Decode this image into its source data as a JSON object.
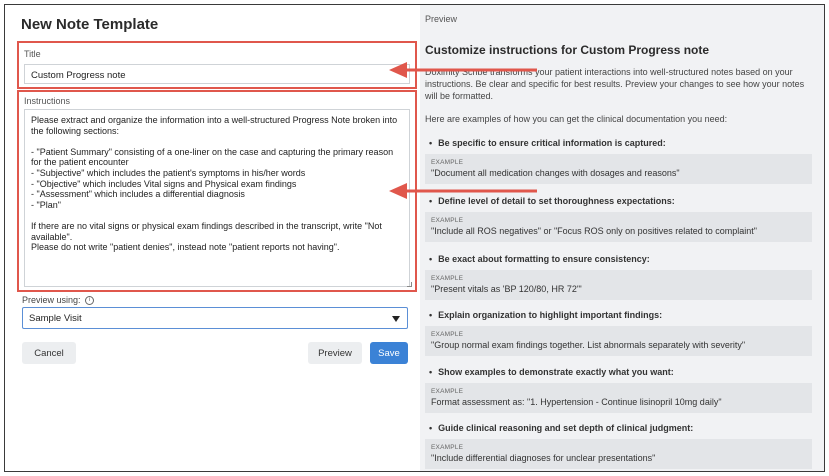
{
  "left": {
    "heading": "New Note Template",
    "title_label": "Title",
    "title_value": "Custom Progress note",
    "instructions_label": "Instructions",
    "instructions_value": "Please extract and organize the information into a well-structured Progress Note broken into the following sections:\n\n- \"Patient Summary\" consisting of a one-liner on the case and capturing the primary reason for the patient encounter\n- \"Subjective\" which includes the patient's symptoms in his/her words\n- \"Objective\" which includes Vital signs and Physical exam findings\n- \"Assessment\" which includes a differential diagnosis\n- \"Plan\"\n\nIf there are no vital signs or physical exam findings described in the transcript, write \"Not available\".\nPlease do not write \"patient denies\", instead note \"patient reports not having\".",
    "preview_using_label": "Preview using:",
    "preview_select_value": "Sample Visit",
    "cancel_label": "Cancel",
    "preview_label": "Preview",
    "save_label": "Save"
  },
  "right": {
    "tab_label": "Preview",
    "title": "Customize instructions for Custom Progress note",
    "intro": "Doximity Scribe transforms your patient interactions into well-structured notes based on your instructions. Be clear and specific for best results. Preview your changes to see how your notes will be formatted.",
    "examples_lead": "Here are examples of how you can get the clinical documentation you need:",
    "tips": [
      {
        "heading": "Be specific to ensure critical information is captured:",
        "example_label": "EXAMPLE",
        "example": "\"Document all medication changes with dosages and reasons\""
      },
      {
        "heading": "Define level of detail to set thoroughness expectations:",
        "example_label": "EXAMPLE",
        "example": "\"Include all ROS negatives\" or \"Focus ROS only on positives related to complaint\""
      },
      {
        "heading": "Be exact about formatting to ensure consistency:",
        "example_label": "EXAMPLE",
        "example": "\"Present vitals as 'BP 120/80, HR 72'\""
      },
      {
        "heading": "Explain organization to highlight important findings:",
        "example_label": "EXAMPLE",
        "example": "\"Group normal exam findings together. List abnormals separately with severity\""
      },
      {
        "heading": "Show examples to demonstrate exactly what you want:",
        "example_label": "EXAMPLE",
        "example": "Format assessment as: \"1. Hypertension - Continue lisinopril 10mg daily\""
      },
      {
        "heading": "Guide clinical reasoning and set depth of clinical judgment:",
        "example_label": "EXAMPLE",
        "example": "\"Include differential diagnoses for unclear presentations\""
      }
    ]
  },
  "colors": {
    "highlight_red": "#e0574c",
    "save_blue": "#3b82d6",
    "panel_gray": "#f1f2f4"
  }
}
